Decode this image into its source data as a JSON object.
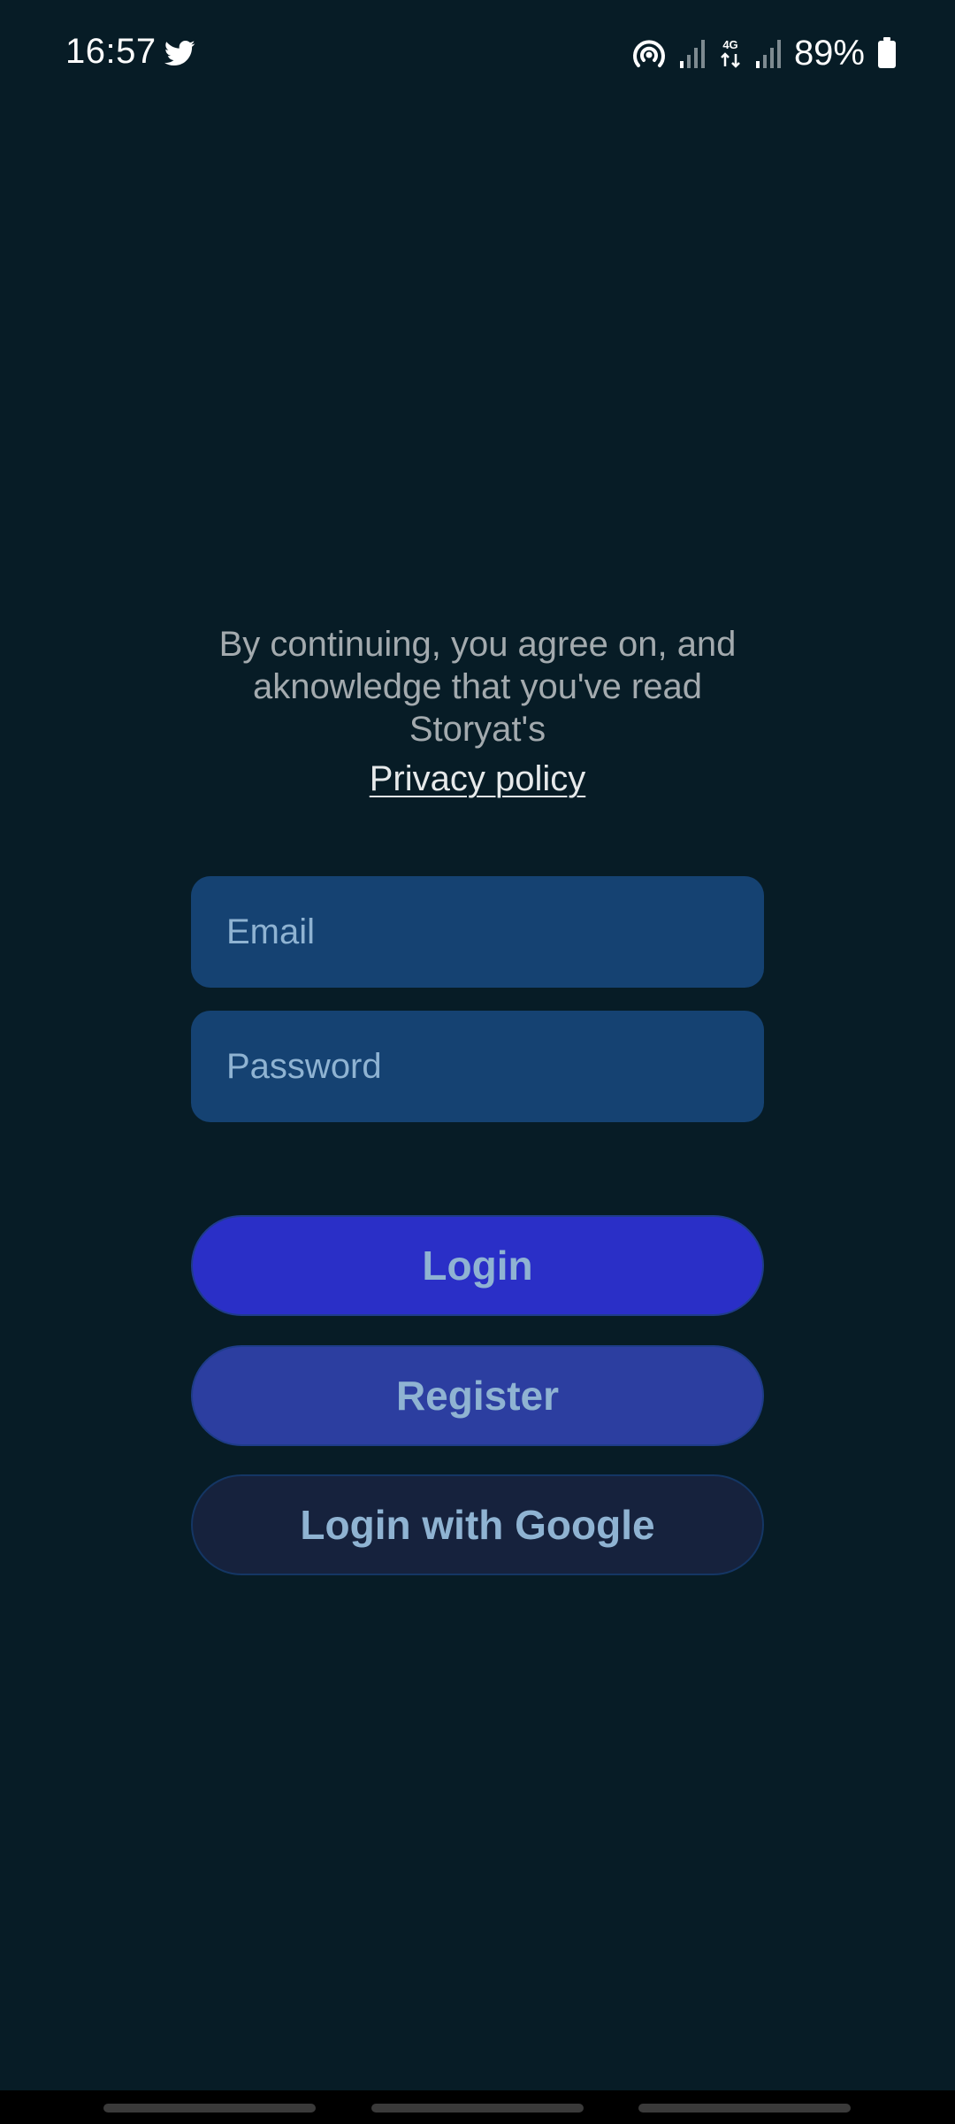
{
  "status_bar": {
    "time": "16:57",
    "battery": "89%",
    "network": "4G",
    "notification_app": "twitter-icon"
  },
  "consent": {
    "text": "By continuing, you agree on, and aknowledge that you've read Storyat's",
    "privacy_link": "Privacy policy"
  },
  "form": {
    "email_placeholder": "Email",
    "password_placeholder": "Password"
  },
  "buttons": {
    "login": "Login",
    "register": "Register",
    "google": "Login with Google"
  },
  "colors": {
    "background": "#071c26",
    "field": "#154272",
    "login_button": "#2a2fc7",
    "register_button": "#2c3ea0",
    "google_button": "#16223d",
    "button_text": "#8fb3d2"
  }
}
